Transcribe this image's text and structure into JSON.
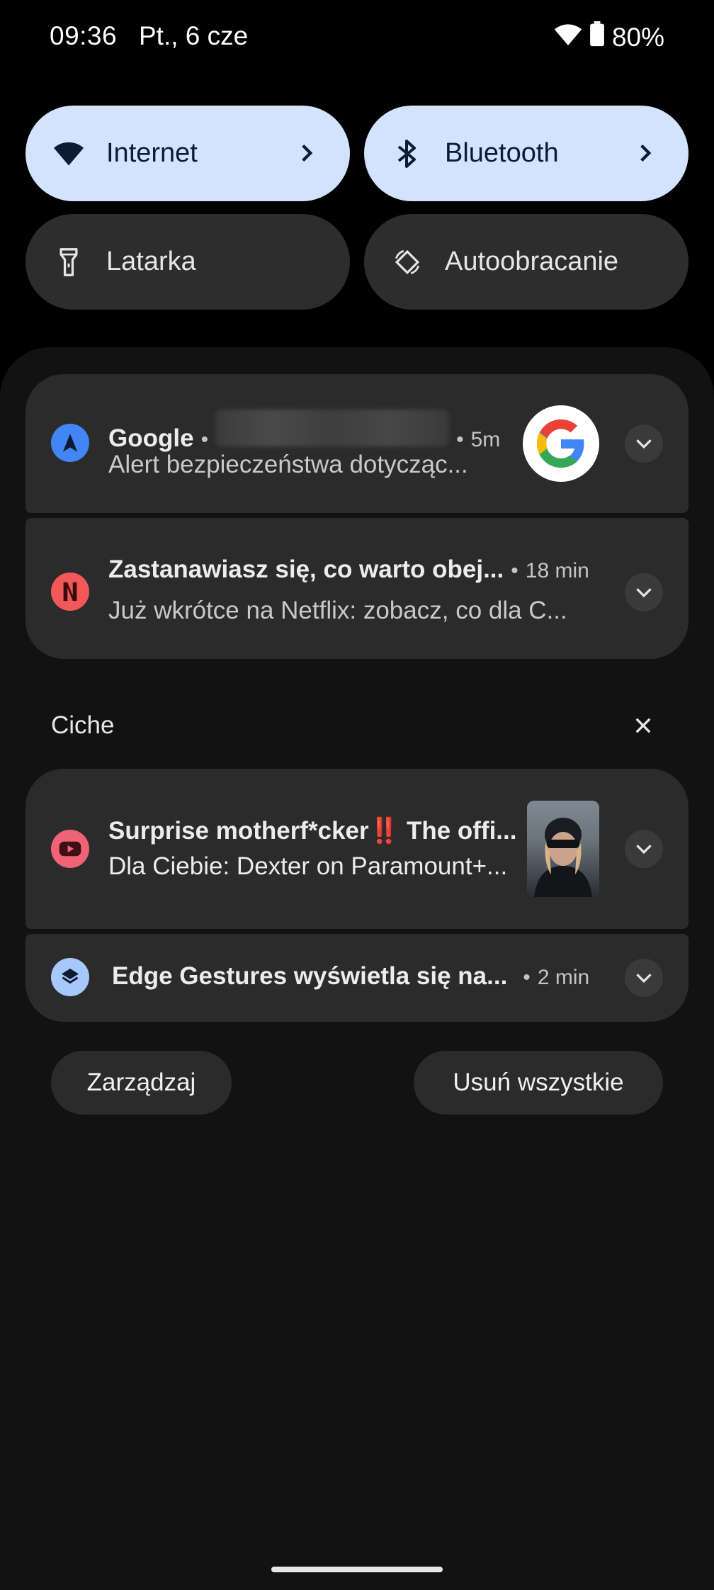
{
  "status_bar": {
    "time": "09:36",
    "date": "Pt., 6 cze",
    "battery": "80%",
    "icons": [
      "wifi-icon",
      "battery-icon"
    ]
  },
  "quick_settings": [
    {
      "label": "Internet",
      "icon": "wifi-icon",
      "active": true,
      "has_chevron": true
    },
    {
      "label": "Bluetooth",
      "icon": "bluetooth-icon",
      "active": true,
      "has_chevron": true
    },
    {
      "label": "Latarka",
      "icon": "flashlight-icon",
      "active": false
    },
    {
      "label": "Autoobracanie",
      "icon": "auto-rotate-icon",
      "active": false
    }
  ],
  "notifications": {
    "google": {
      "app": "Google",
      "time": "5m",
      "text": "Alert bezpieczeństwa dotycząc...",
      "icon": "google-navigation-icon"
    },
    "netflix": {
      "title": "Zastanawiasz się, co warto obej...",
      "time": "18 min",
      "text": "Już wkrótce na Netflix: zobacz, co dla C...",
      "icon": "netflix-icon"
    }
  },
  "silent_section": {
    "title": "Ciche",
    "close_icon": "close-icon"
  },
  "silent_notifications": {
    "youtube": {
      "title": "Surprise motherf*cker‼️ The offi...",
      "text": "Dla Ciebie: Dexter on Paramount+...",
      "icon": "youtube-icon"
    },
    "edge_gestures": {
      "title": "Edge Gestures wyświetla się na...",
      "time": "2 min",
      "icon": "layers-icon"
    }
  },
  "actions": {
    "manage": "Zarządzaj",
    "clear_all": "Usuń wszystkie"
  },
  "colors": {
    "tile_active": "#d3e3fd",
    "tile_inactive": "#2d2d2d",
    "card_bg": "#2b2b2b",
    "shade_bg": "#121212",
    "netflix_red": "#f25858",
    "google_blue": "#4285f4",
    "youtube_pink": "#f06275"
  }
}
